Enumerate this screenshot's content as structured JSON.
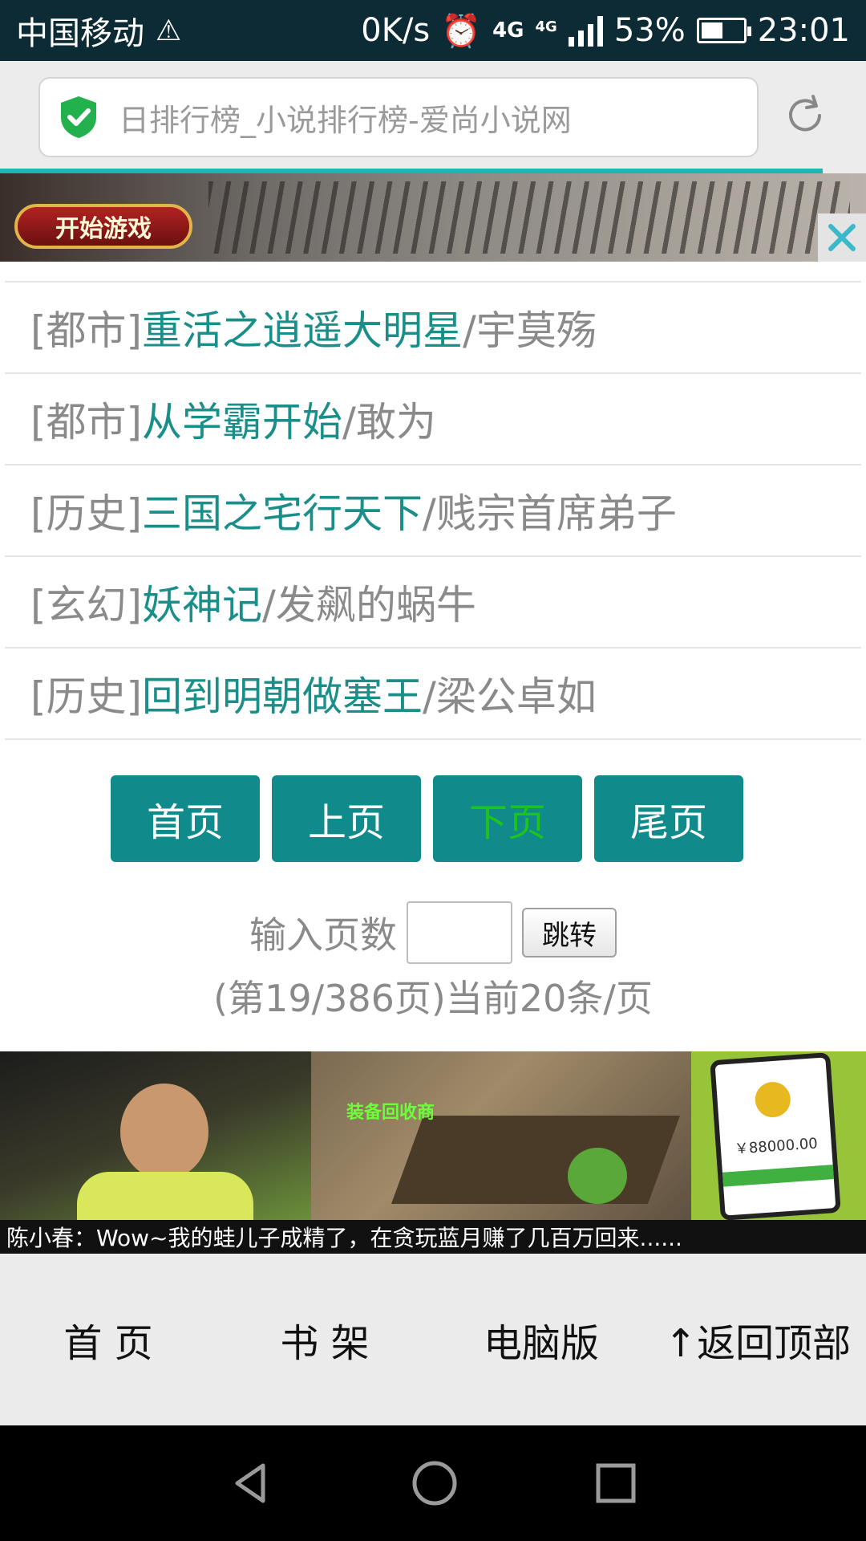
{
  "status_bar": {
    "carrier": "中国移动",
    "net_speed": "0K/s",
    "network_1": "4G",
    "network_2": "4G",
    "battery": "53%",
    "battery_level": 0.53,
    "time": "23:01"
  },
  "address_bar": {
    "page_title": "日排行榜_小说排行榜-爱尚小说网"
  },
  "ad_top": {
    "button_label": "开始游戏"
  },
  "books": [
    {
      "genre": "[都市]",
      "title": "重活之逍遥大明星",
      "author": "/宇莫殇"
    },
    {
      "genre": "[都市]",
      "title": "从学霸开始",
      "author": "/敢为"
    },
    {
      "genre": "[历史]",
      "title": "三国之宅行天下",
      "author": "/贱宗首席弟子"
    },
    {
      "genre": "[玄幻]",
      "title": "妖神记",
      "author": "/发飙的蜗牛"
    },
    {
      "genre": "[历史]",
      "title": "回到明朝做塞王",
      "author": "/梁公卓如"
    }
  ],
  "pager": {
    "first": "首页",
    "prev": "上页",
    "next": "下页",
    "last": "尾页"
  },
  "jump": {
    "label": "输入页数",
    "input_value": "",
    "button": "跳转"
  },
  "page_info": "(第19/386页)当前20条/页",
  "ad_bottom": {
    "recycler_label": "装备回收商",
    "amount": "￥88000.00",
    "caption": "陈小春：Wow~我的蛙儿子成精了，在贪玩蓝月赚了几百万回来......"
  },
  "footer": {
    "home": "首 页",
    "bookshelf": "书 架",
    "desktop": "电脑版",
    "back_to_top": "↑返回顶部"
  },
  "colors": {
    "accent": "#108a8a",
    "title_link": "#1a8f8a",
    "current_page": "#1cc41c",
    "status_bar": "#0d2b35"
  }
}
